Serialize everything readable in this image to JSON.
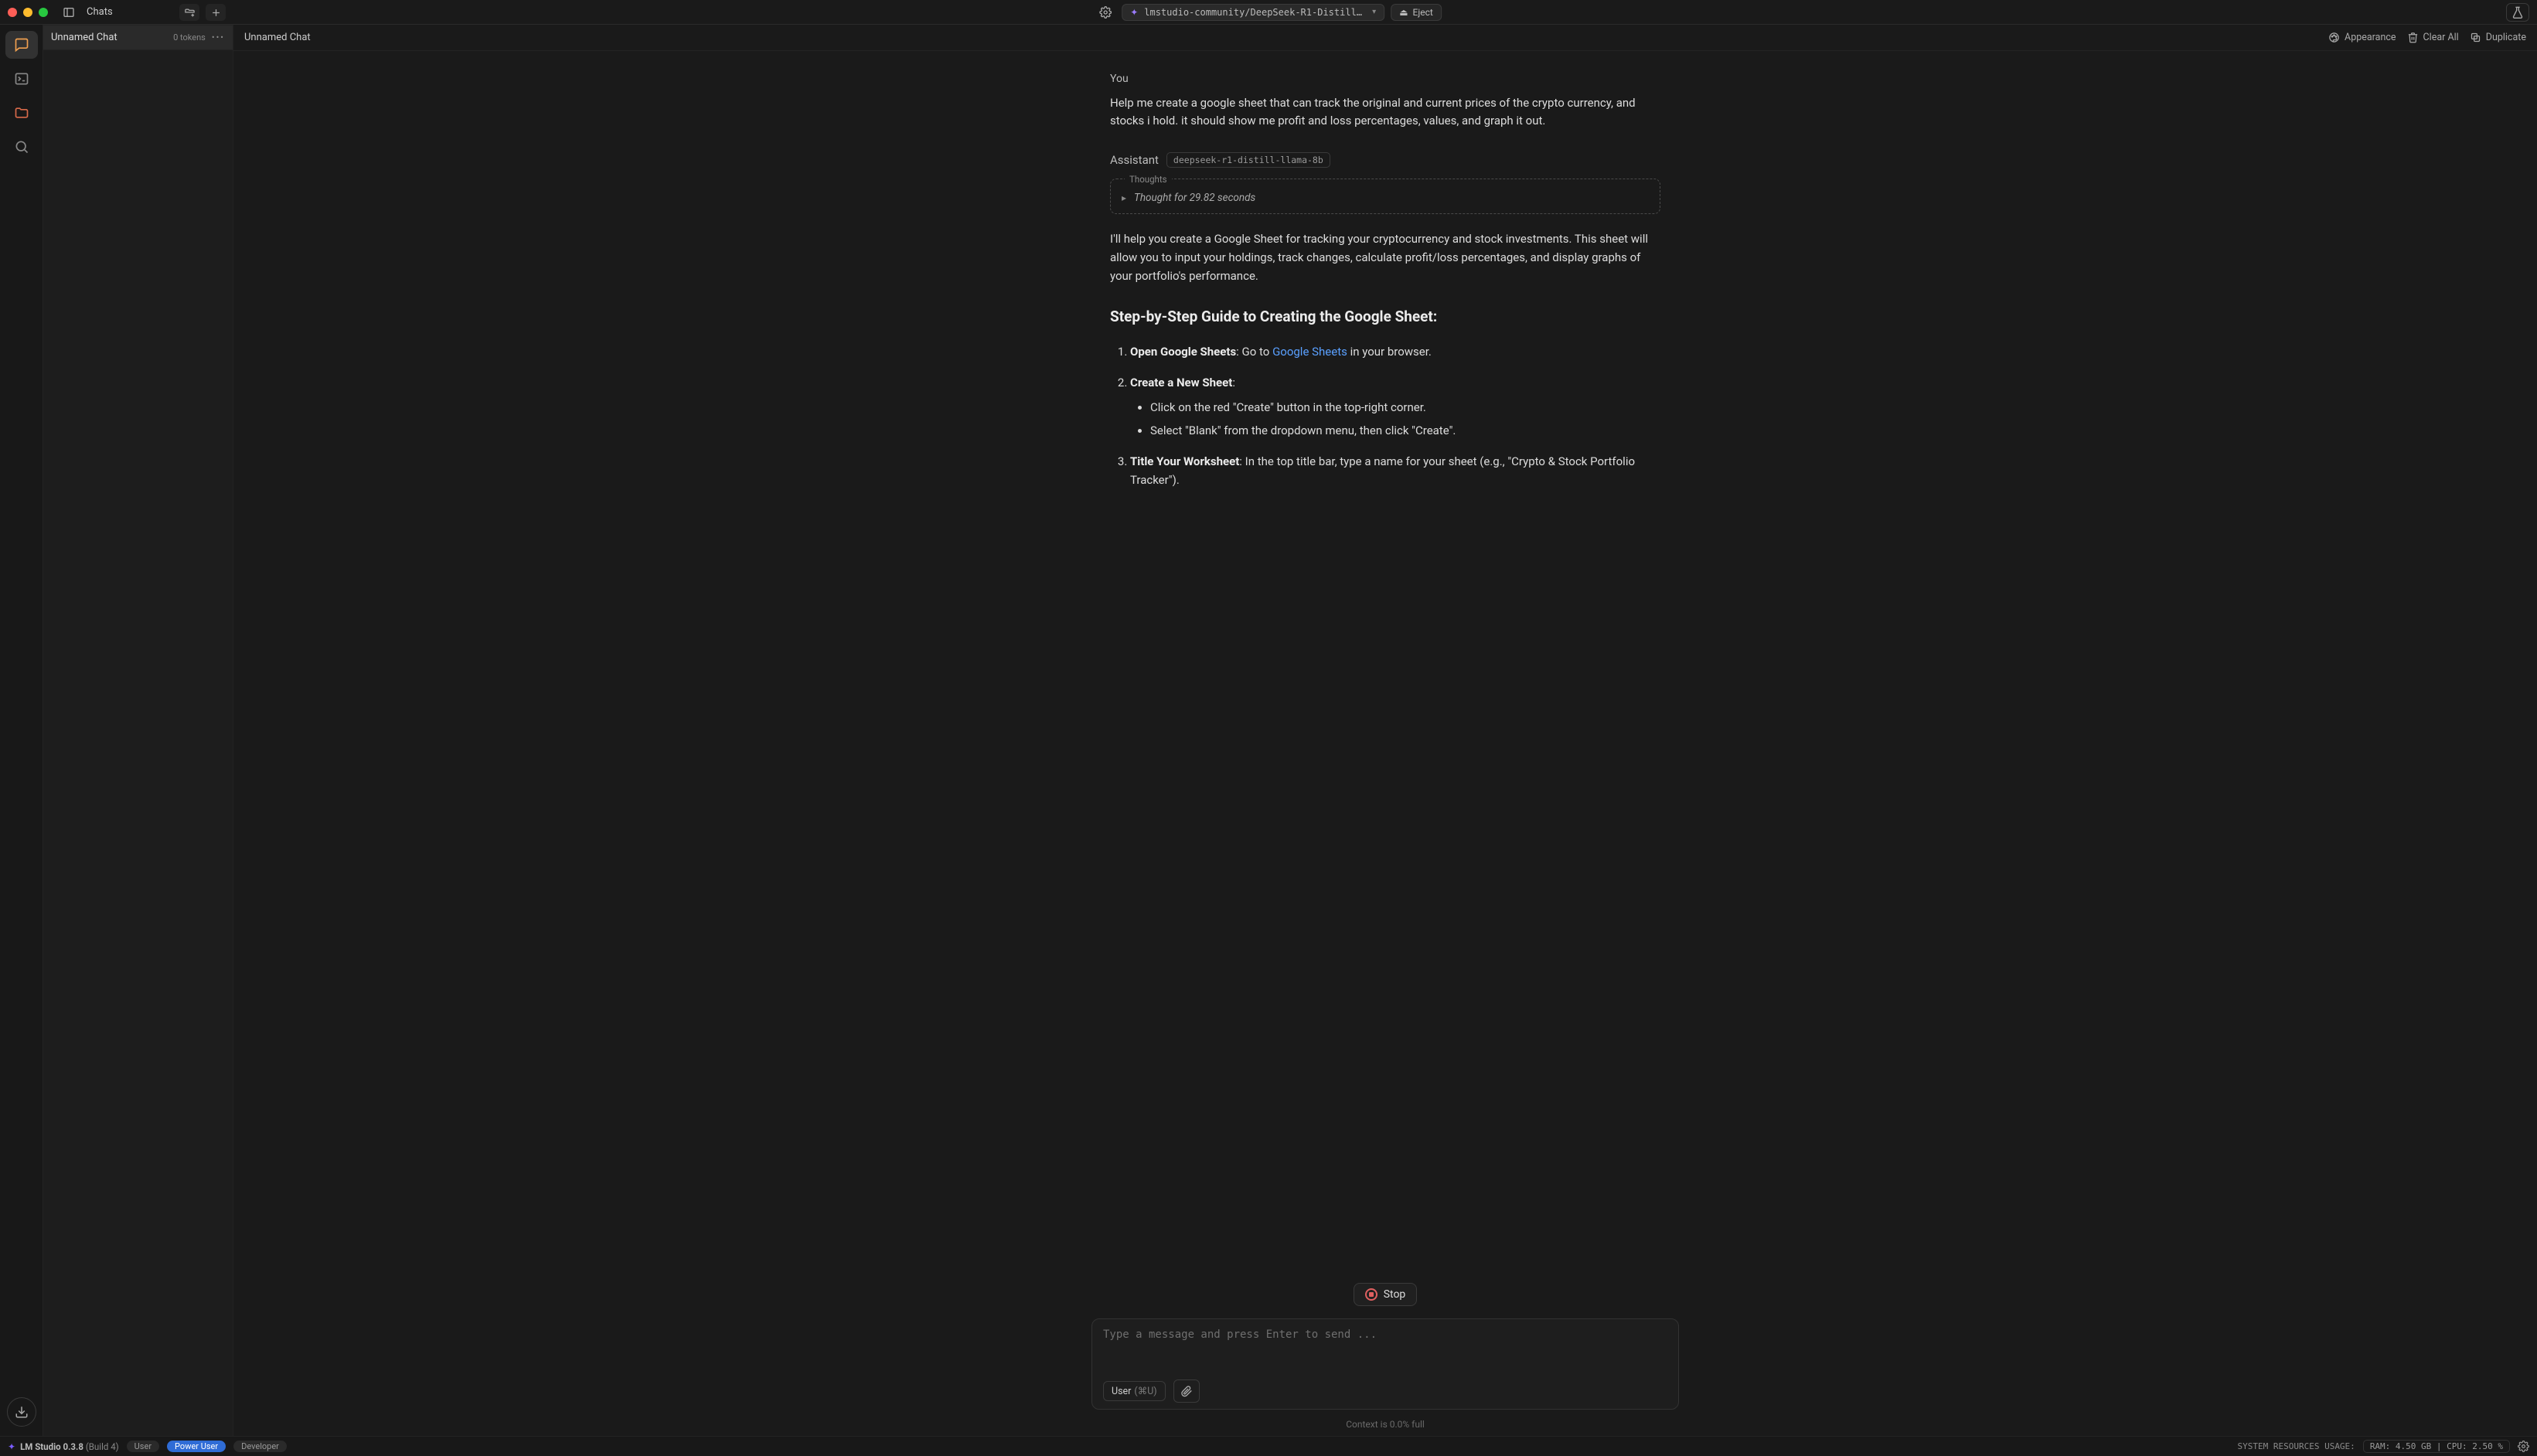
{
  "titlebar": {
    "section": "Chats",
    "model_name": "lmstudio-community/DeepSeek-R1-Distill-Llama-8B-…",
    "eject_label": "Eject"
  },
  "sidebar": {
    "items": [
      {
        "name": "Unnamed Chat",
        "tokens": "0 tokens"
      }
    ]
  },
  "subheader": {
    "title": "Unnamed Chat",
    "appearance": "Appearance",
    "clear_all": "Clear All",
    "duplicate": "Duplicate"
  },
  "chat": {
    "you_label": "You",
    "user_message": "Help me create a google sheet that can track the original and current prices of the crypto currency, and stocks i hold. it should show me profit and loss percentages, values, and graph it out.",
    "assistant_label": "Assistant",
    "assistant_model_chip": "deepseek-r1-distill-llama-8b",
    "thoughts_legend": "Thoughts",
    "thoughts_summary": "Thought for 29.82 seconds",
    "assistant_intro": "I'll help you create a Google Sheet for tracking your cryptocurrency and stock investments. This sheet will allow you to input your holdings, track changes, calculate profit/loss percentages, and display graphs of your portfolio's performance.",
    "heading": "Step-by-Step Guide to Creating the Google Sheet:",
    "li1_strong": "Open Google Sheets",
    "li1_pre": ": Go to ",
    "li1_link": "Google Sheets",
    "li1_post": " in your browser.",
    "li2_strong": "Create a New Sheet",
    "li2_post": ":",
    "li2_sub1": "Click on the red \"Create\" button in the top-right corner.",
    "li2_sub2": "Select \"Blank\" from the dropdown menu, then click \"Create\".",
    "li3_strong": "Title Your Worksheet",
    "li3_post": ": In the top title bar, type a name for your sheet (e.g., \"Crypto & Stock Portfolio Tracker\")."
  },
  "stop_label": "Stop",
  "composer": {
    "placeholder": "Type a message and press Enter to send ...",
    "role_label": "User",
    "role_hint": "(⌘U)"
  },
  "context_line": "Context is 0.0% full",
  "statusbar": {
    "app": "LM Studio 0.3.8",
    "build": "(Build 4)",
    "badge_user": "User",
    "badge_power": "Power User",
    "badge_dev": "Developer",
    "sys_label": "SYSTEM RESOURCES USAGE:",
    "sys_value": "RAM: 4.50 GB | CPU: 2.50 %"
  }
}
